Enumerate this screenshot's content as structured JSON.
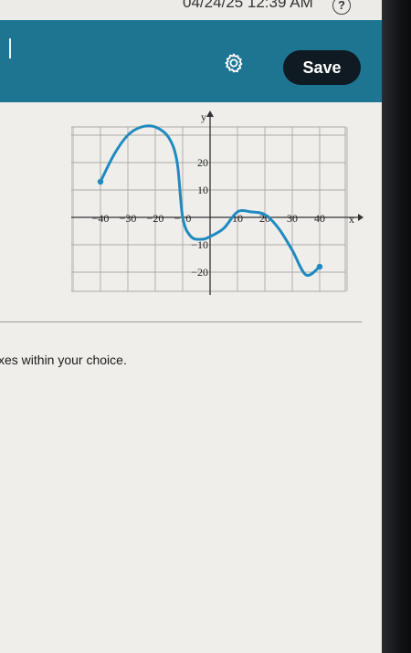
{
  "status": {
    "datetime": "04/24/25 12:39 AM",
    "help_glyph": "?"
  },
  "toolbar": {
    "save_label": "Save",
    "settings_icon": "gear-icon",
    "accent_color": "#1e7592"
  },
  "graph": {
    "x_axis_label": "x",
    "y_axis_label": "y",
    "x_tick_labels": [
      "−40",
      "−30",
      "−20",
      "−10",
      "10",
      "20",
      "30",
      "40"
    ],
    "y_tick_labels": [
      "20",
      "10",
      "−10",
      "−20"
    ],
    "curve_color": "#1f8ac0"
  },
  "chart_data": {
    "type": "line",
    "xlabel": "x",
    "ylabel": "y",
    "xlim": [
      -50,
      50
    ],
    "ylim": [
      -27,
      33
    ],
    "grid": true,
    "x_ticks": [
      -40,
      -30,
      -20,
      -10,
      10,
      20,
      30,
      40
    ],
    "y_ticks": [
      -20,
      -10,
      10,
      20
    ],
    "series": [
      {
        "x": [
          -40,
          -35,
          -30,
          -25,
          -20,
          -15,
          -12,
          -10,
          -7,
          -3,
          0,
          5,
          10,
          15,
          20,
          25,
          30,
          35,
          40
        ],
        "y": [
          13,
          23,
          30,
          33,
          33,
          29,
          20,
          0,
          -7,
          -8,
          -7,
          -4,
          2,
          2,
          1,
          -4,
          -12,
          -21,
          -18
        ],
        "endpoints": "closed"
      }
    ]
  },
  "instruction_text": "xes within your choice."
}
